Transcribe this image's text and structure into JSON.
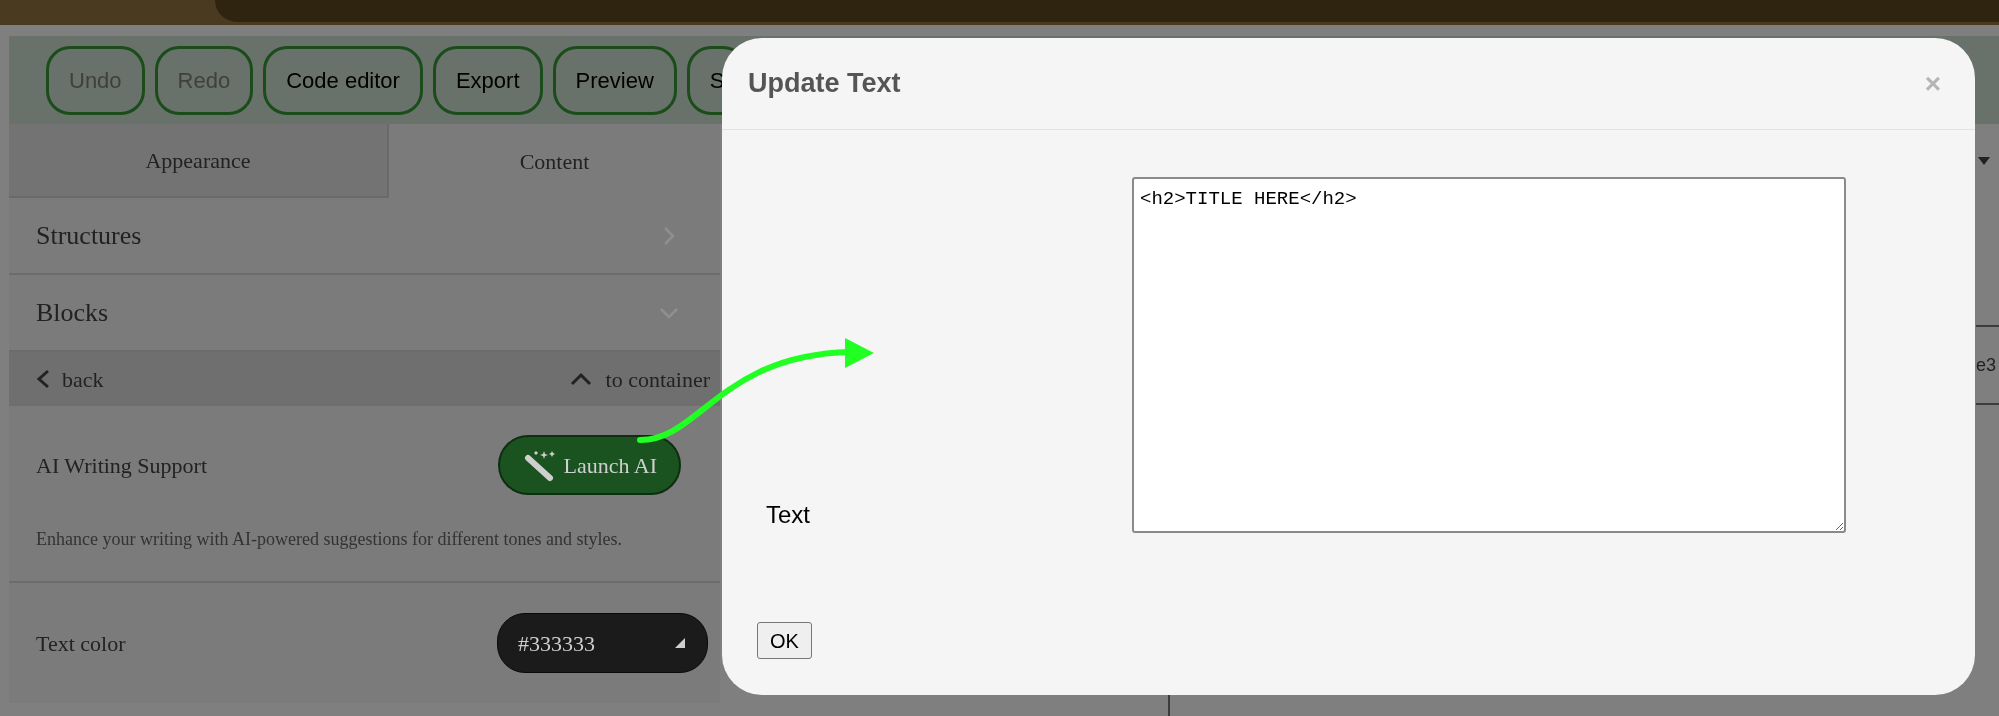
{
  "toolbar": {
    "buttons": [
      {
        "label": "Undo",
        "disabled": true
      },
      {
        "label": "Redo",
        "disabled": true
      },
      {
        "label": "Code editor",
        "disabled": false
      },
      {
        "label": "Export",
        "disabled": false
      },
      {
        "label": "Preview",
        "disabled": false
      },
      {
        "label": "S",
        "disabled": false
      }
    ]
  },
  "tabs": [
    {
      "label": "Appearance",
      "selected": false
    },
    {
      "label": "Content",
      "selected": true
    }
  ],
  "sections": [
    {
      "label": "Structures",
      "expanded": false
    },
    {
      "label": "Blocks",
      "expanded": true
    }
  ],
  "nav": {
    "back": "back",
    "up": "to container"
  },
  "ai": {
    "label": "AI Writing Support",
    "button": "Launch AI",
    "description": "Enhance your writing with AI-powered suggestions for different tones and styles."
  },
  "text_color": {
    "label": "Text color",
    "value": "#333333"
  },
  "background_fragment": "e3",
  "dialog": {
    "title": "Update Text",
    "close": "×",
    "field_label": "Text",
    "value": "<h2>TITLE HERE</h2>",
    "ok": "OK"
  }
}
